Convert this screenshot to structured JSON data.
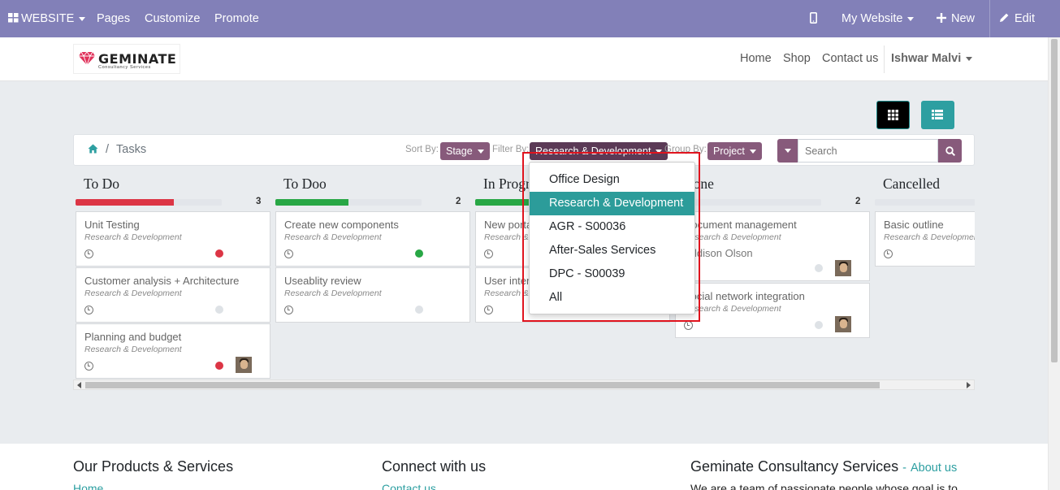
{
  "topbar": {
    "website_menu": "WEBSITE",
    "pages": "Pages",
    "customize": "Customize",
    "promote": "Promote",
    "site_selector": "My Website",
    "new": "New",
    "edit": "Edit"
  },
  "header": {
    "logo_text": "GEMINATE",
    "logo_sub": "Consultancy Services",
    "nav": [
      "Home",
      "Shop",
      "Contact us"
    ],
    "user": "Ishwar Malvi"
  },
  "controls": {
    "breadcrumb_current": "Tasks",
    "breadcrumb_sep": "/",
    "sort_label": "Sort By:",
    "sort_value": "Stage",
    "filter_label": "Filter By:",
    "filter_value": "Research & Development",
    "group_label": "Group By:",
    "group_value": "Project",
    "search_placeholder": "Search"
  },
  "columns": [
    {
      "title": "To Do",
      "count": "3",
      "progress_color": "#dc3545",
      "progress": 0.67,
      "cards": [
        {
          "title": "Unit Testing",
          "project": "Research & Development",
          "status": "#dc3545",
          "avatar": false
        },
        {
          "title": "Customer analysis + Architecture",
          "project": "Research & Development",
          "status": "#dee2e6",
          "avatar": false
        },
        {
          "title": "Planning and budget",
          "project": "Research & Development",
          "status": "#dc3545",
          "avatar": true
        }
      ]
    },
    {
      "title": "To Doo",
      "count": "2",
      "progress_color": "#28a745",
      "progress": 0.5,
      "cards": [
        {
          "title": "Create new components",
          "project": "Research & Development",
          "status": "#28a745",
          "avatar": false
        },
        {
          "title": "Useablity review",
          "project": "Research & Development",
          "status": "#dee2e6",
          "avatar": false
        }
      ]
    },
    {
      "title": "In Progress",
      "count": "",
      "progress_color": "#28a745",
      "progress": 0.5,
      "cards": [
        {
          "title": "New portal",
          "project": "Research & Development",
          "status": "",
          "avatar": false
        },
        {
          "title": "User interface",
          "project": "Research & Development",
          "status": "",
          "avatar": false
        }
      ]
    },
    {
      "title": "Done",
      "count": "2",
      "progress_color": "#28a745",
      "progress": 0,
      "cards": [
        {
          "title": "Document management",
          "project": "Research & Development",
          "assignee": "Addison Olson",
          "status": "#dee2e6",
          "avatar": true
        },
        {
          "title": "Social network integration",
          "project": "Research & Development",
          "status": "#dee2e6",
          "avatar": true
        }
      ]
    },
    {
      "title": "Cancelled",
      "count": "",
      "progress_color": "#28a745",
      "progress": 0,
      "cards": [
        {
          "title": "Basic outline",
          "project": "Research & Development",
          "status": "",
          "avatar": false
        }
      ]
    }
  ],
  "filter_dropdown": {
    "items": [
      "Office Design",
      "Research & Development",
      "AGR - S00036",
      "After-Sales Services",
      "DPC - S00039",
      "All"
    ],
    "active": "Research & Development"
  },
  "footer": {
    "col1_title": "Our Products & Services",
    "col1_link": "Home",
    "col2_title": "Connect with us",
    "col2_link": "Contact us",
    "col3_title": "Geminate Consultancy Services",
    "col3_about": "About us",
    "col3_text": "We are a team of passionate people whose goal is to"
  },
  "colors": {
    "topbar": "#8280b8",
    "accent_purple": "#875a7b",
    "accent_teal": "#2d9fa1",
    "highlight_box": "#e0141e"
  }
}
